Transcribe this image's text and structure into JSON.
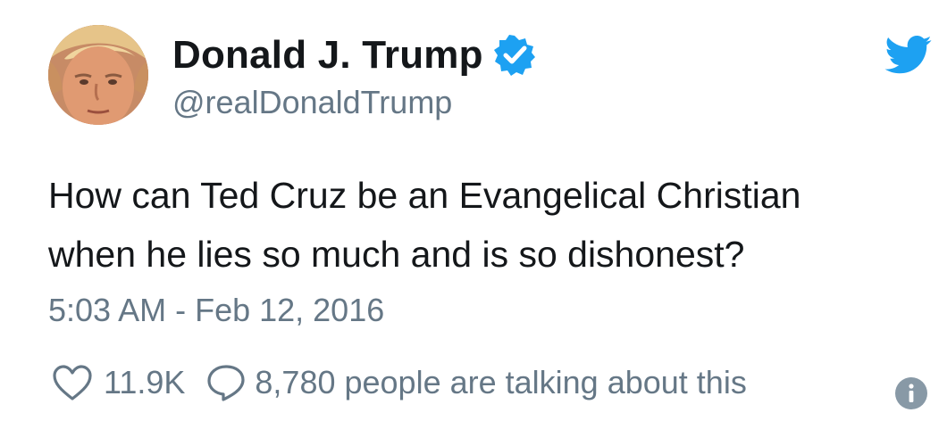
{
  "tweet": {
    "display_name": "Donald J. Trump",
    "handle": "@realDonaldTrump",
    "verified": true,
    "text_line1": "How can Ted Cruz be an Evangelical Christian",
    "text_line2": "when he lies so much and is so dishonest?",
    "timestamp": "5:03 AM - Feb 12, 2016",
    "likes": "11.9K",
    "talking": "8,780 people are talking about this"
  },
  "icons": {
    "avatar": "profile-photo",
    "verified": "verified-badge-icon",
    "brand": "twitter-bird-icon",
    "like": "heart-icon",
    "reply": "speech-bubble-icon",
    "info": "info-icon"
  },
  "colors": {
    "brand_blue": "#1da1f2",
    "text_primary": "#14171a",
    "text_secondary": "#657786",
    "info_gray": "#8899a6"
  }
}
